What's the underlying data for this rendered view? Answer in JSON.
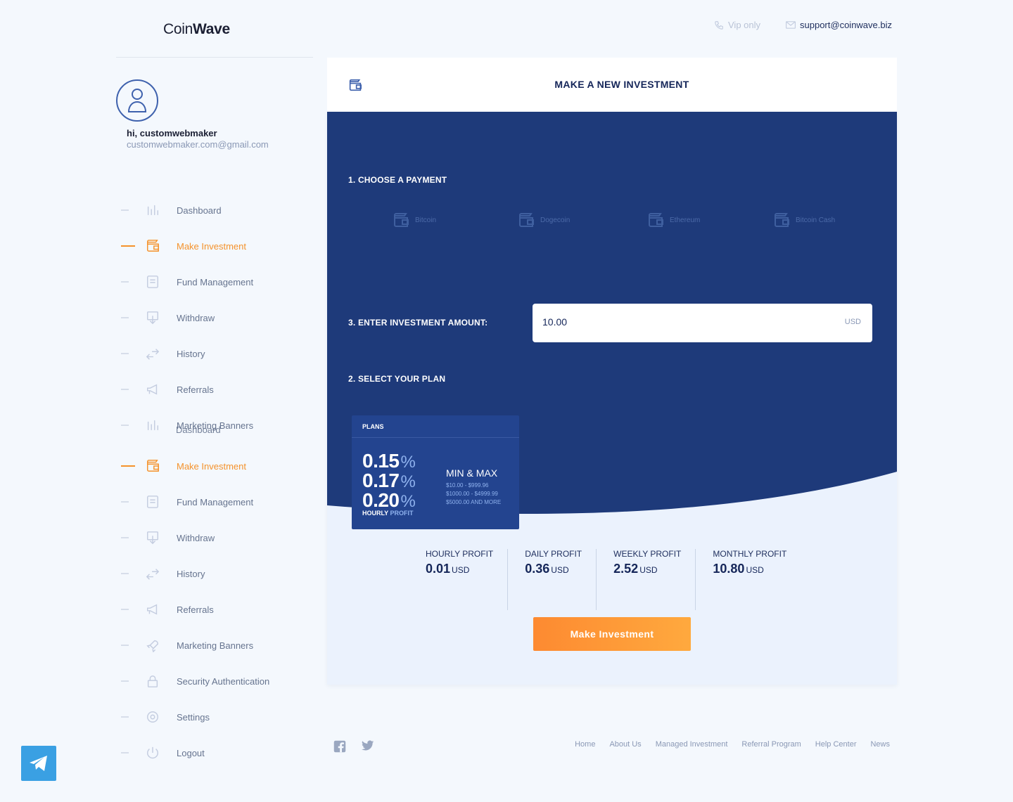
{
  "brand": {
    "name_light": "Coin",
    "name_bold": "Wave"
  },
  "header": {
    "vip_label": "Vip only",
    "support_email": "support@coinwave.biz"
  },
  "user": {
    "greeting": "hi, customwebmaker",
    "email": "customwebmaker.com@gmail.com"
  },
  "sidebar": {
    "ghost_label": "Dashboard",
    "items": [
      {
        "label": "Dashboard",
        "icon": "chart-bars-icon",
        "active": false
      },
      {
        "label": "Make Investment",
        "icon": "wallet-icon",
        "active": true
      },
      {
        "label": "Fund Management",
        "icon": "document-icon",
        "active": false
      },
      {
        "label": "Withdraw",
        "icon": "withdraw-icon",
        "active": false
      },
      {
        "label": "History",
        "icon": "arrows-swap-icon",
        "active": false
      },
      {
        "label": "Referrals",
        "icon": "megaphone-icon",
        "active": false
      },
      {
        "label": "Marketing Banners",
        "icon": "chart-bars-icon",
        "active": false
      },
      {
        "label": "Make Investment",
        "icon": "wallet-icon",
        "active": true
      },
      {
        "label": "Fund Management",
        "icon": "document-icon",
        "active": false
      },
      {
        "label": "Withdraw",
        "icon": "withdraw-icon",
        "active": false
      },
      {
        "label": "History",
        "icon": "arrows-swap-icon",
        "active": false
      },
      {
        "label": "Referrals",
        "icon": "megaphone-icon",
        "active": false
      },
      {
        "label": "Marketing Banners",
        "icon": "rocket-icon",
        "active": false
      },
      {
        "label": "Security Authentication",
        "icon": "lock-icon",
        "active": false
      },
      {
        "label": "Settings",
        "icon": "gear-icon",
        "active": false
      },
      {
        "label": "Logout",
        "icon": "power-icon",
        "active": false
      }
    ]
  },
  "investment": {
    "title": "MAKE A NEW INVESTMENT",
    "step1": "1. CHOOSE A PAYMENT",
    "payments": [
      "Bitcoin",
      "Dogecoin",
      "Ethereum",
      "Bitcoin Cash"
    ],
    "step3": "3. ENTER INVESTMENT AMOUNT:",
    "amount_value": "10.00",
    "amount_unit": "USD",
    "step2": "2. SELECT YOUR PLAN",
    "plan": {
      "header": "PLANS",
      "rates": [
        "0.15",
        "0.17",
        "0.20"
      ],
      "percent_sign": "%",
      "hourly_label": "HOURLY",
      "profit_word": "PROFIT",
      "minmax_title": "MIN & MAX",
      "ranges": [
        "$10.00 - $999.96",
        "$1000.00 - $4999.99",
        "$5000.00 AND MORE"
      ]
    },
    "profits": [
      {
        "label": "HOURLY PROFIT",
        "value": "0.01",
        "unit": "USD"
      },
      {
        "label": "DAILY PROFIT",
        "value": "0.36",
        "unit": "USD"
      },
      {
        "label": "WEEKLY PROFIT",
        "value": "2.52",
        "unit": "USD"
      },
      {
        "label": "MONTHLY PROFIT",
        "value": "10.80",
        "unit": "USD"
      }
    ],
    "button_label": "Make Investment"
  },
  "footer": {
    "social": [
      "facebook-icon",
      "twitter-icon"
    ],
    "links": [
      "Home",
      "About Us",
      "Managed Investment",
      "Referral Program",
      "Help Center",
      "News"
    ]
  },
  "colors": {
    "accent": "#f5922b",
    "navy": "#1e3a7a",
    "panel": "#ebf2fd"
  }
}
